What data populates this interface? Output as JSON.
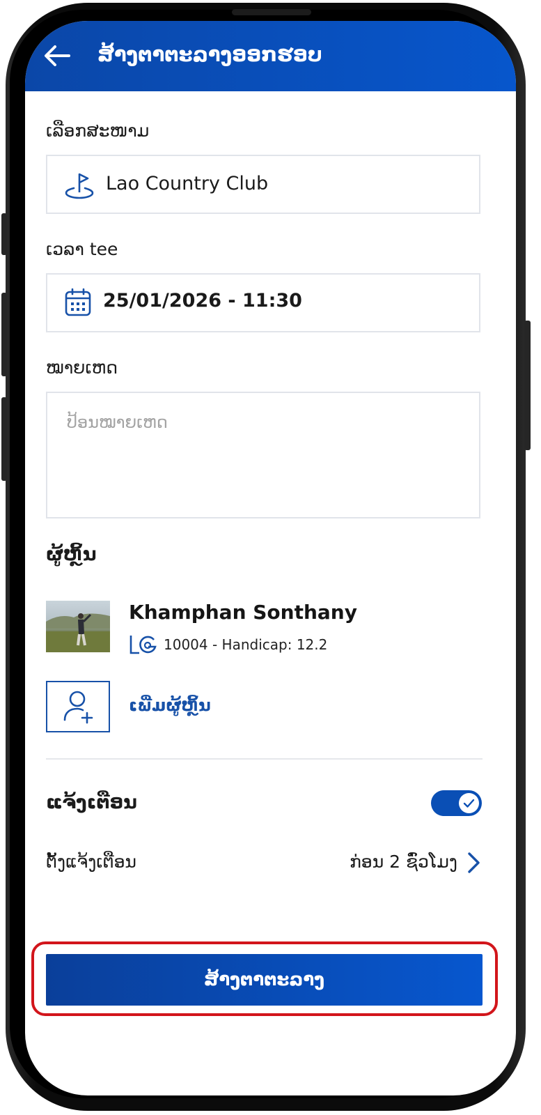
{
  "header": {
    "title": "ສ້າງຕາຕະລາງອອກຮອບ",
    "back_icon": "arrow-left-icon"
  },
  "course": {
    "label": "ເລືອກສະໜາມ",
    "value": "Lao Country Club",
    "icon": "golf-flag-icon"
  },
  "tee_time": {
    "label": "ເວລາ tee",
    "value": "25/01/2026 - 11:30",
    "icon": "calendar-icon"
  },
  "notes": {
    "label": "ໝາຍເຫດ",
    "placeholder": "ປ້ອນໝາຍເຫດ",
    "value": ""
  },
  "players": {
    "title": "ຜູ້ຫຼິ້ນ",
    "items": [
      {
        "name": "Khamphan Sonthany",
        "member_info": "10004 - Handicap: 12.2",
        "badge_icon": "lcg-logo-icon"
      }
    ],
    "add_label": "ເພີ່ມຜູ້ຫຼິ້ນ",
    "add_icon": "add-user-icon"
  },
  "reminder": {
    "title": "ແຈ້ງເຕືອນ",
    "enabled": true,
    "setting_label": "ຕັ້ງແຈ້ງເຕືອນ",
    "setting_value": "ກ່ອນ 2 ຊົ່ວໂມງ"
  },
  "submit": {
    "label": "ສ້າງຕາຕະລາງ"
  },
  "colors": {
    "primary": "#0a4fb5",
    "highlight": "#d2151b"
  }
}
